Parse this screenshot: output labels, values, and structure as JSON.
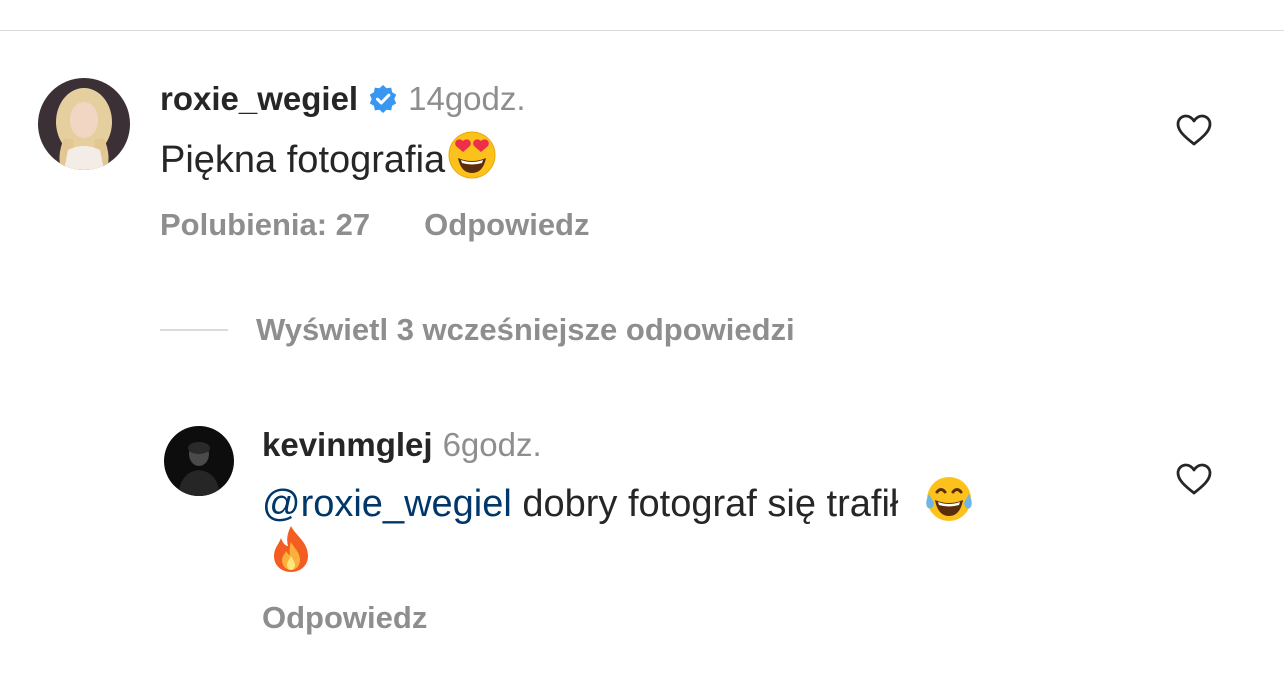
{
  "comment": {
    "username": "roxie_wegiel",
    "time": "14godz.",
    "text": "Piękna fotografia",
    "likes_label": "Polubienia: 27",
    "reply_label": "Odpowiedz"
  },
  "view_replies": {
    "label": "Wyświetl 3 wcześniejsze odpowiedzi"
  },
  "reply": {
    "username": "kevinmglej",
    "time": "6godz.",
    "mention": "@roxie_wegiel",
    "text": " dobry fotograf się trafił",
    "reply_label": "Odpowiedz"
  },
  "colors": {
    "text": "#262626",
    "secondary": "#8e8e8e",
    "mention": "#00376b",
    "verified": "#3897f0",
    "divider": "#dbdbdb"
  },
  "icons": {
    "verified": "verified-badge-icon",
    "heart": "heart-outline-icon",
    "emoji_heart_eyes": "heart-eyes-emoji",
    "emoji_laugh": "tears-of-joy-emoji",
    "emoji_fire": "fire-emoji"
  }
}
